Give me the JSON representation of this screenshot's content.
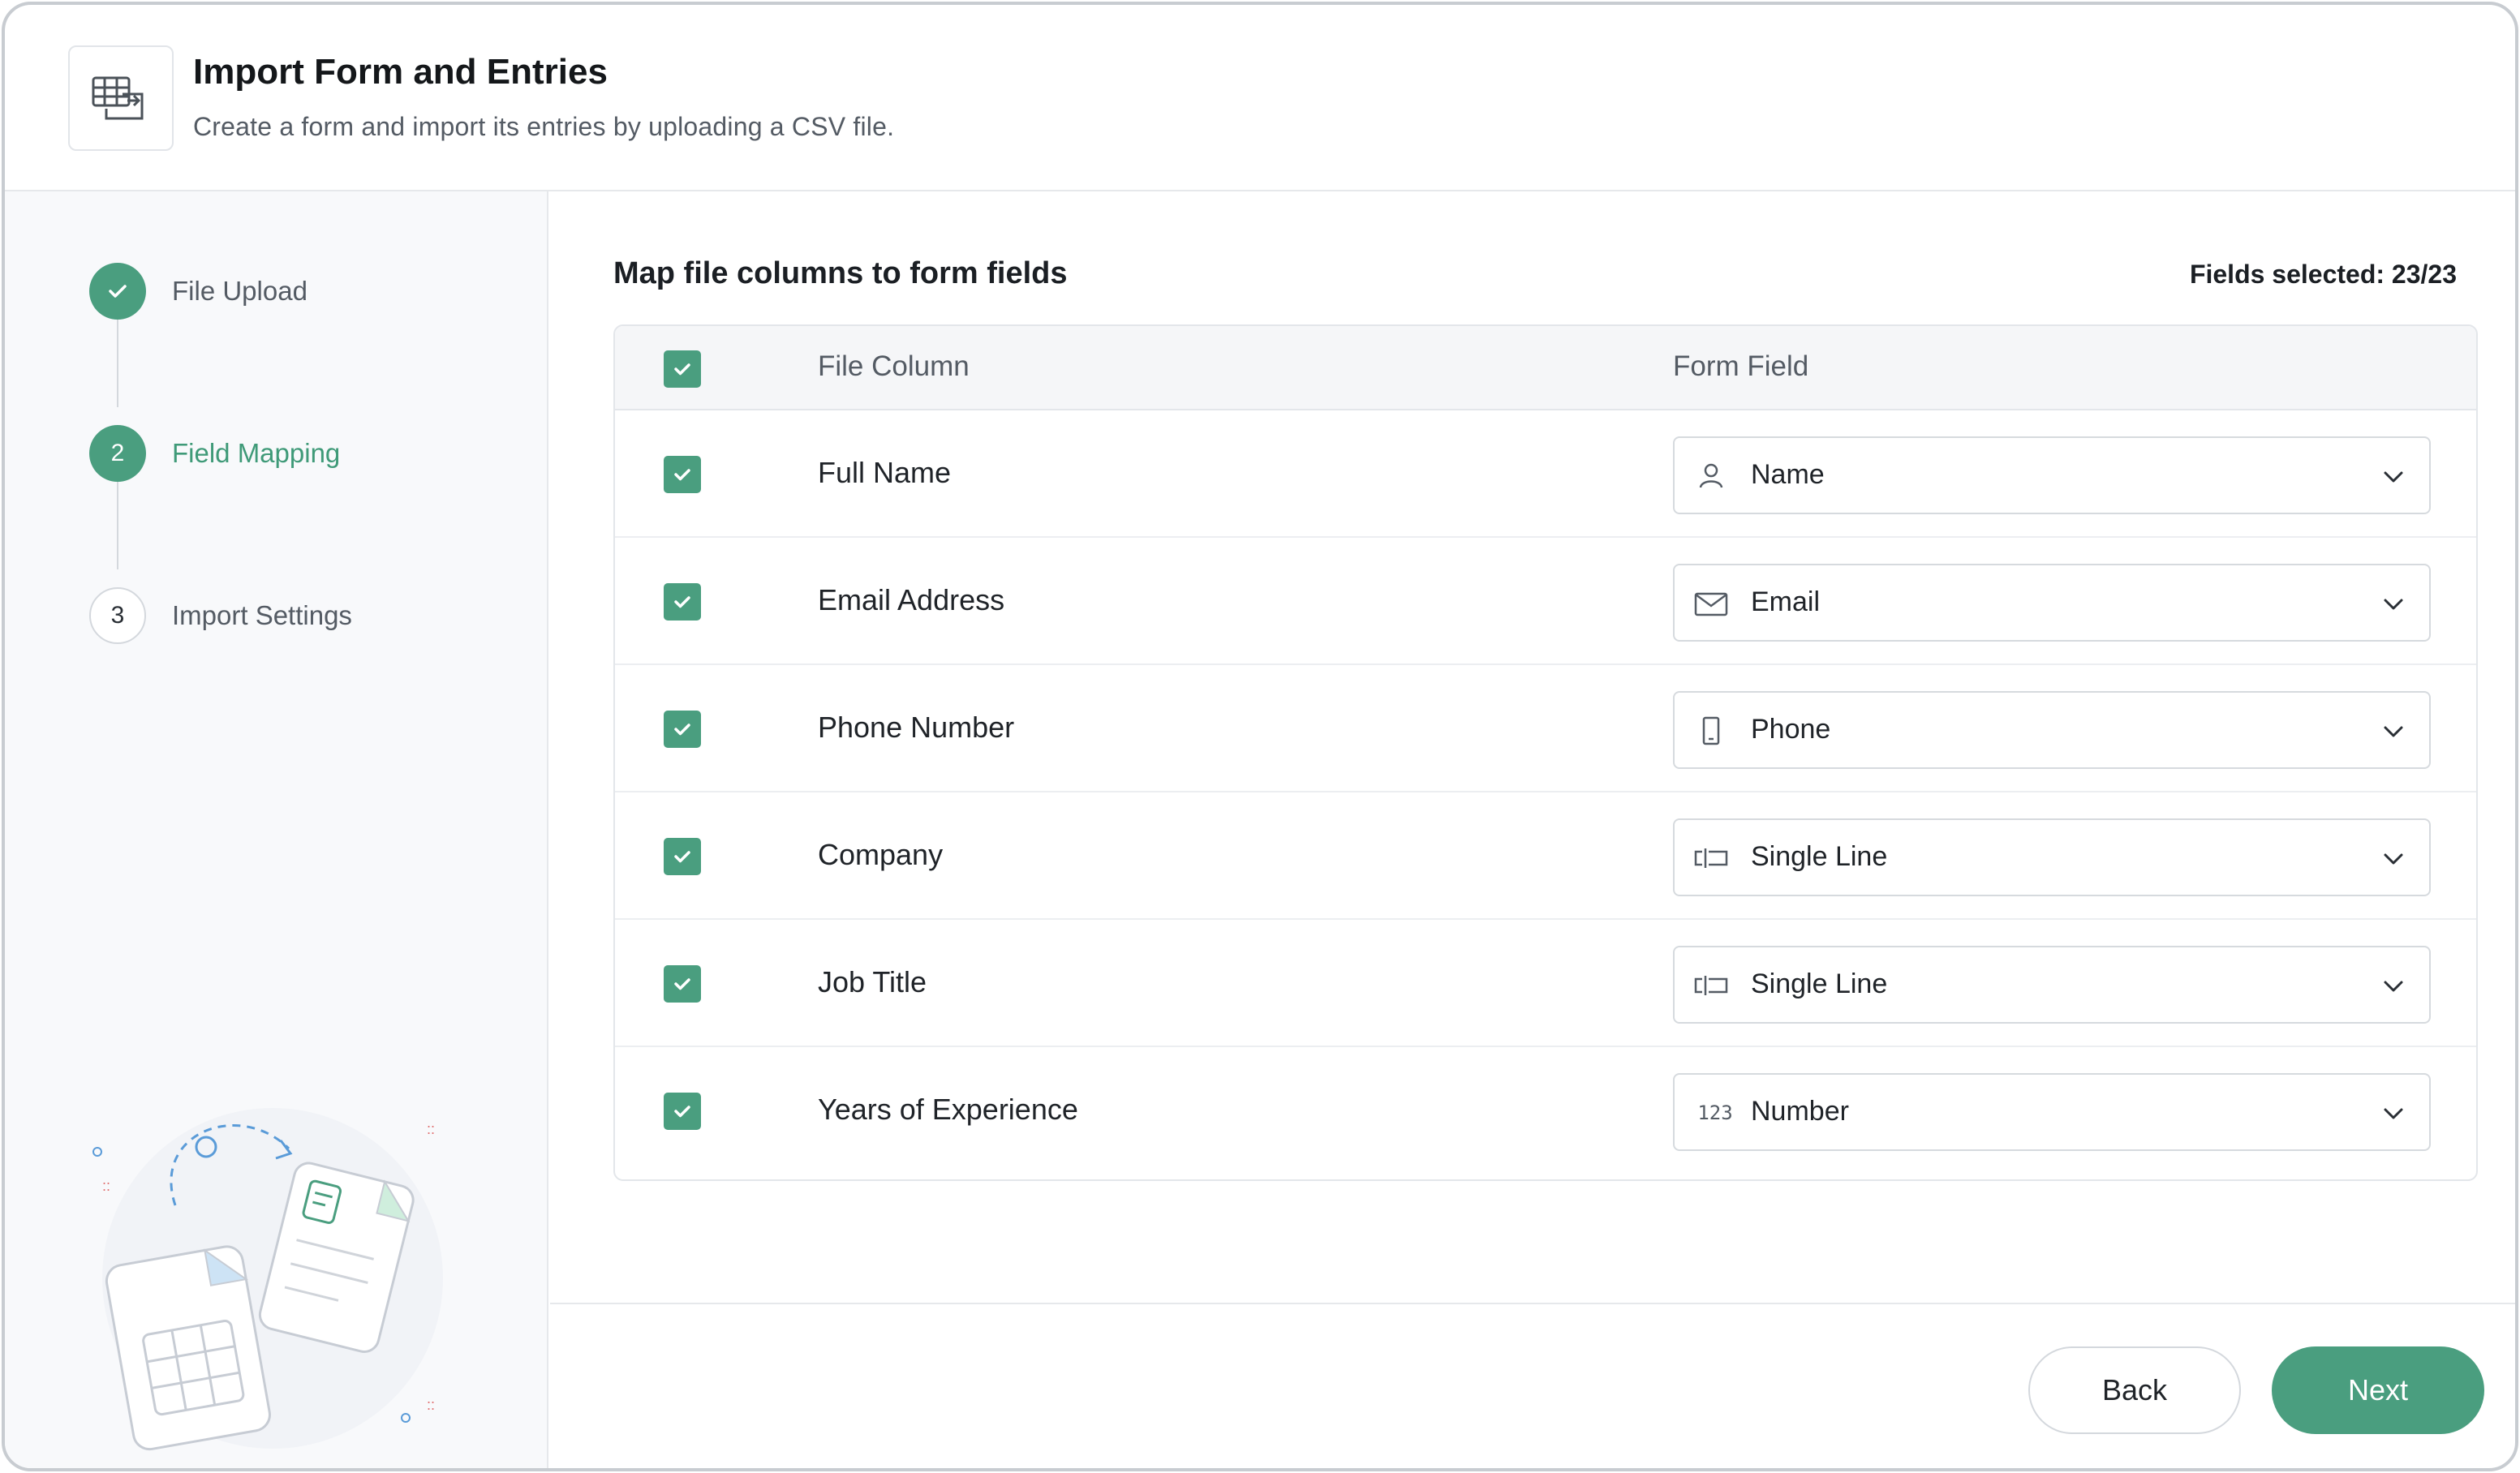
{
  "header": {
    "title": "Import Form and Entries",
    "subtitle": "Create a form and import its entries by uploading a CSV file.",
    "icon": "import-table-icon"
  },
  "steps": [
    {
      "number": "",
      "label": "File Upload",
      "state": "done"
    },
    {
      "number": "2",
      "label": "Field Mapping",
      "state": "active"
    },
    {
      "number": "3",
      "label": "Import Settings",
      "state": "todo"
    }
  ],
  "mapping": {
    "title": "Map file columns to form fields",
    "fields_selected": "Fields selected: 23/23",
    "columns": {
      "file_column": "File Column",
      "form_field": "Form Field"
    },
    "rows": [
      {
        "file_column": "Full Name",
        "form_field": "Name",
        "icon": "person-icon",
        "checked": true
      },
      {
        "file_column": "Email Address",
        "form_field": "Email",
        "icon": "envelope-icon",
        "checked": true
      },
      {
        "file_column": "Phone Number",
        "form_field": "Phone",
        "icon": "phone-icon",
        "checked": true
      },
      {
        "file_column": "Company",
        "form_field": "Single Line",
        "icon": "single-line-icon",
        "checked": true
      },
      {
        "file_column": "Job Title",
        "form_field": "Single Line",
        "icon": "single-line-icon",
        "checked": true
      },
      {
        "file_column": "Years of Experience",
        "form_field": "Number",
        "icon": "number-icon",
        "icon_text": "123",
        "checked": true
      }
    ]
  },
  "footer": {
    "back_label": "Back",
    "next_label": "Next"
  },
  "colors": {
    "accent": "#4a9e7f",
    "accent_text": "#3f9a78",
    "border": "#e3e6ea"
  }
}
